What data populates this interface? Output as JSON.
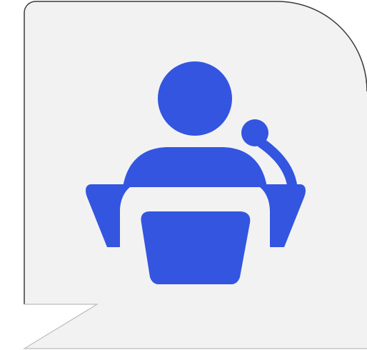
{
  "icon": {
    "name": "speaker-at-podium-icon",
    "bubble_color": "#f2f2f2",
    "bubble_outline_color": "#3a3a3a",
    "bubble_tail_outline_color": "#bdbdbd",
    "figure_color": "#3355e0"
  }
}
